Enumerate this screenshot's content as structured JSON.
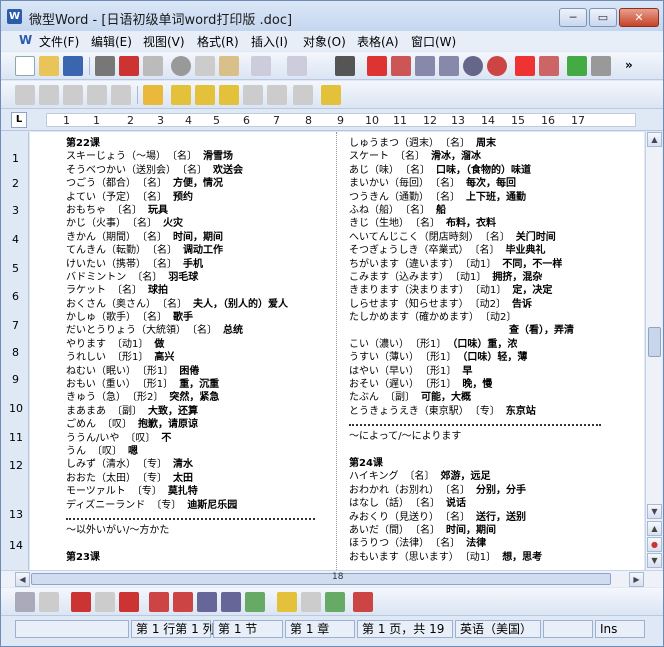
{
  "window": {
    "title": "微型Word - [日语初级单词word打印版 .doc]",
    "app_icon": "W",
    "min_label": "▭",
    "max_label": "▭",
    "close_label": "✕"
  },
  "menu": [
    "文件(F)",
    "编辑(E)",
    "视图(V)",
    "格式(R)",
    "插入(I)",
    "对象(O)",
    "表格(A)",
    "窗口(W)"
  ],
  "mdi": {
    "min": "_",
    "restore": "❐",
    "close": "×"
  },
  "ruler": {
    "corner": "L",
    "numbers": [
      "1",
      "1",
      "2",
      "3",
      "4",
      "5",
      "6",
      "7",
      "8",
      "9",
      "10",
      "11",
      "12",
      "13",
      "14",
      "15",
      "16",
      "17"
    ]
  },
  "vruler": {
    "numbers": [
      "1",
      "2",
      "3",
      "4",
      "5",
      "6",
      "7",
      "8",
      "9",
      "10",
      "11",
      "12",
      "13",
      "14"
    ]
  },
  "page_marker": "18",
  "column1": [
    {
      "head": "第22课",
      "type": "heading"
    },
    {
      "kana": "スキーじょう（～場）",
      "pos": "〔名〕",
      "mean": "滑雪场"
    },
    {
      "kana": "そうべつかい（送別会）",
      "pos": "〔名〕",
      "mean": "欢送会"
    },
    {
      "kana": "つごう（都合）",
      "pos": "〔名〕",
      "mean": "方便，情况"
    },
    {
      "kana": "よてい（予定）",
      "pos": "〔名〕",
      "mean": "预约"
    },
    {
      "kana": "おもちゃ",
      "pos": "〔名〕",
      "mean": "玩具"
    },
    {
      "kana": "かじ（火事）",
      "pos": "〔名〕",
      "mean": "火灾"
    },
    {
      "kana": "きかん（期間）",
      "pos": "〔名〕",
      "mean": "时间，期间"
    },
    {
      "kana": "てんきん（転勤）",
      "pos": "〔名〕",
      "mean": "调动工作"
    },
    {
      "kana": "けいたい（携帯）",
      "pos": "〔名〕",
      "mean": "手机"
    },
    {
      "kana": "バドミントン",
      "pos": "〔名〕",
      "mean": "羽毛球"
    },
    {
      "kana": "ラケット",
      "pos": "〔名〕",
      "mean": "球拍"
    },
    {
      "kana": "おくさん（奥さん）",
      "pos": "〔名〕",
      "mean": "夫人，（别人的）爱人"
    },
    {
      "kana": "かしゅ（歌手）",
      "pos": "〔名〕",
      "mean": "歌手"
    },
    {
      "kana": "だいとうりょう（大統領）",
      "pos": "〔名〕",
      "mean": "总统"
    },
    {
      "kana": "やります",
      "pos": "〔动1〕",
      "mean": "做"
    },
    {
      "kana": "うれしい",
      "pos": "〔形1〕",
      "mean": "高兴"
    },
    {
      "kana": "ねむい（眠い）",
      "pos": "〔形1〕",
      "mean": "困倦"
    },
    {
      "kana": "おもい（重い）",
      "pos": "〔形1〕",
      "mean": "重，沉重"
    },
    {
      "kana": "きゅう（急）",
      "pos": "〔形2〕",
      "mean": "突然，紧急"
    },
    {
      "kana": "まあまあ",
      "pos": "〔副〕",
      "mean": "大致，还算"
    },
    {
      "kana": "ごめん",
      "pos": "〔叹〕",
      "mean": "抱歉，请原谅"
    },
    {
      "kana": "ううん/いや",
      "pos": "〔叹〕",
      "mean": "不"
    },
    {
      "kana": "うん",
      "pos": "〔叹〕",
      "mean": "嗯"
    },
    {
      "kana": "しみず（清水）",
      "pos": "〔专〕",
      "mean": "清水"
    },
    {
      "kana": "おおた（太田）",
      "pos": "〔专〕",
      "mean": "太田"
    },
    {
      "kana": "モーツァルト",
      "pos": "〔专〕",
      "mean": "莫扎特"
    },
    {
      "kana": "ディズニーランド",
      "pos": "〔专〕",
      "mean": "迪斯尼乐园"
    },
    {
      "type": "dots"
    },
    {
      "head": "～以外いがい/～方かた",
      "type": "plain"
    },
    {
      "type": "blank"
    },
    {
      "head": "第23课",
      "type": "heading"
    }
  ],
  "column2": [
    {
      "kana": "しゅうまつ（週末）",
      "pos": "〔名〕",
      "mean": "周末"
    },
    {
      "kana": "スケート",
      "pos": "〔名〕",
      "mean": "滑冰，溜冰"
    },
    {
      "kana": "あじ（味）",
      "pos": "〔名〕",
      "mean": "口味，（食物的）味道"
    },
    {
      "kana": "まいかい（毎回）",
      "pos": "〔名〕",
      "mean": "每次，每回"
    },
    {
      "kana": "つうきん（通勤）",
      "pos": "〔名〕",
      "mean": "上下班，通勤"
    },
    {
      "kana": "ふね（船）",
      "pos": "〔名〕",
      "mean": "船"
    },
    {
      "kana": "きじ（生地）",
      "pos": "〔名〕",
      "mean": "布料，衣料"
    },
    {
      "kana": "へいてんじこく（閉店時刻）",
      "pos": "〔名〕",
      "mean": "关门时间"
    },
    {
      "kana": "そつぎょうしき（卒業式）",
      "pos": "〔名〕",
      "mean": "毕业典礼"
    },
    {
      "kana": "ちがいます（違います）",
      "pos": "〔动1〕",
      "mean": "不同，不一样"
    },
    {
      "kana": "こみます（込みます）",
      "pos": "〔动1〕",
      "mean": "拥挤，混杂"
    },
    {
      "kana": "きまります（決まります）",
      "pos": "〔动1〕",
      "mean": "定，决定"
    },
    {
      "kana": "しらせます（知らせます）",
      "pos": "〔动2〕",
      "mean": "告诉"
    },
    {
      "kana": "たしかめます（確かめます）",
      "pos": "〔动2〕",
      "mean": ""
    },
    {
      "head": "查（看），弄清",
      "type": "right"
    },
    {
      "kana": "こい（濃い）",
      "pos": "〔形1〕",
      "mean": "（口味）重，浓"
    },
    {
      "kana": "うすい（薄い）",
      "pos": "〔形1〕",
      "mean": "（口味）轻，薄"
    },
    {
      "kana": "はやい（早い）",
      "pos": "〔形1〕",
      "mean": "早"
    },
    {
      "kana": "おそい（遅い）",
      "pos": "〔形1〕",
      "mean": "晚，慢"
    },
    {
      "kana": "たぶん",
      "pos": "〔副〕",
      "mean": "可能，大概"
    },
    {
      "kana": "とうきょうえき（東京駅）",
      "pos": "〔专〕",
      "mean": "东京站"
    },
    {
      "type": "dots"
    },
    {
      "head": "～によって/～によります",
      "type": "plain"
    },
    {
      "type": "blank"
    },
    {
      "head": "第24课",
      "type": "heading"
    },
    {
      "kana": "ハイキング",
      "pos": "〔名〕",
      "mean": "郊游，远足"
    },
    {
      "kana": "おわかれ（お別れ）",
      "pos": "〔名〕",
      "mean": "分别，分手"
    },
    {
      "kana": "はなし（話）",
      "pos": "〔名〕",
      "mean": "说话"
    },
    {
      "kana": "みおくり（見送り）",
      "pos": "〔名〕",
      "mean": "送行，送别"
    },
    {
      "kana": "あいだ（間）",
      "pos": "〔名〕",
      "mean": "时间，期间"
    },
    {
      "kana": "ほうりつ（法律）",
      "pos": "〔名〕",
      "mean": "法律"
    },
    {
      "kana": "おもいます（思います）",
      "pos": "〔动1〕",
      "mean": "想，思考"
    }
  ],
  "status": {
    "position": "第 1 行第 1 列",
    "section": "第 1 节",
    "chapter": "第 1 章",
    "page": "第 1 页，共 19",
    "language": "英语（美国）",
    "mode": "Ins"
  },
  "toolbar_overflow": "»"
}
